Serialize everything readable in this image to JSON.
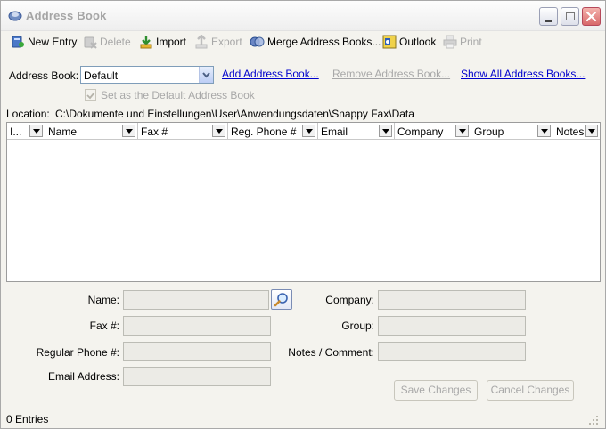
{
  "window": {
    "title": "Address Book"
  },
  "toolbar": {
    "new_entry": "New Entry",
    "delete": "Delete",
    "import": "Import",
    "export": "Export",
    "merge": "Merge Address Books...",
    "outlook": "Outlook",
    "print": "Print"
  },
  "address_book": {
    "label": "Address Book:",
    "selected": "Default",
    "add_link": "Add Address Book...",
    "remove_link": "Remove Address Book...",
    "show_all_link": "Show All Address Books...",
    "default_checkbox": "Set as the Default Address Book",
    "default_checked": true
  },
  "location": {
    "label": "Location:",
    "path": "C:\\Dokumente und Einstellungen\\User\\Anwendungsdaten\\Snappy Fax\\Data"
  },
  "grid": {
    "columns": [
      "I...",
      "Name",
      "Fax #",
      "Reg. Phone #",
      "Email",
      "Company",
      "Group",
      "Notes"
    ],
    "rows": []
  },
  "form": {
    "name_label": "Name:",
    "fax_label": "Fax #:",
    "phone_label": "Regular Phone #:",
    "email_label": "Email Address:",
    "company_label": "Company:",
    "group_label": "Group:",
    "notes_label": "Notes / Comment:",
    "name_value": "",
    "fax_value": "",
    "phone_value": "",
    "email_value": "",
    "company_value": "",
    "group_value": "",
    "notes_value": ""
  },
  "buttons": {
    "save": "Save Changes",
    "cancel": "Cancel Changes"
  },
  "status": {
    "entries": "0 Entries"
  },
  "colors": {
    "link": "#0000cc",
    "disabled_text": "#a8a8a8",
    "window_bg": "#f4f3ee",
    "close_button": "#d8686a"
  },
  "icons": {
    "app": "address-book-icon",
    "new_entry": "new-entry-icon",
    "delete": "delete-icon",
    "import": "import-icon",
    "export": "export-icon",
    "merge": "merge-icon",
    "outlook": "outlook-icon",
    "print": "print-icon",
    "search": "search-icon"
  }
}
